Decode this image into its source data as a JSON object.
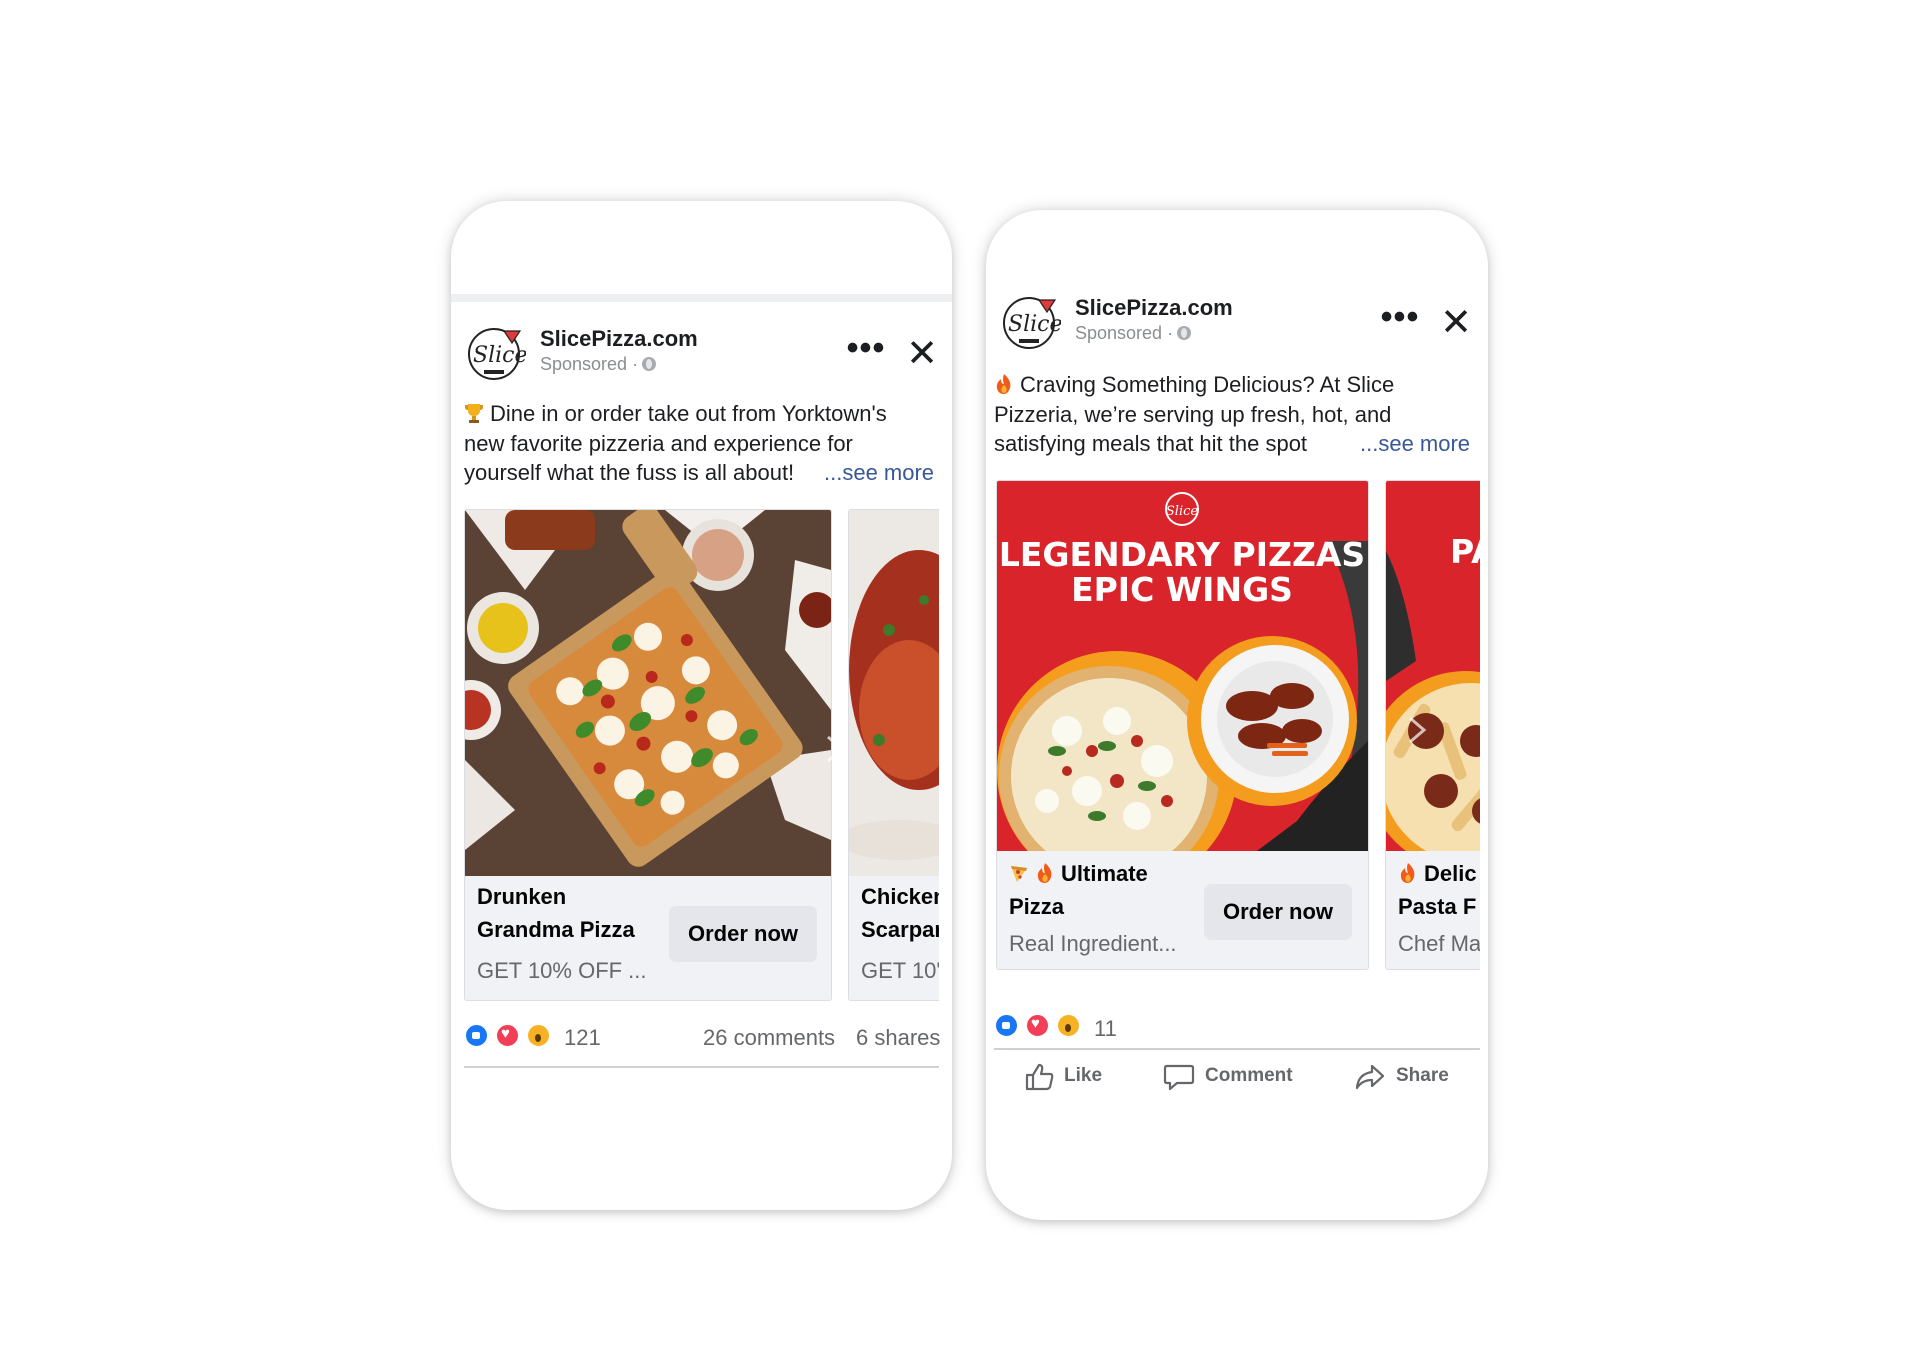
{
  "ad1": {
    "page_name": "SlicePizza.com",
    "sponsored": "Sponsored ·",
    "more_label": "•••",
    "close_label": "✕",
    "text_lines": [
      "Dine in or order take out from Yorktown's",
      "new favorite pizzeria and experience for",
      "yourself what the fuss is all about!"
    ],
    "see_more": "...see more",
    "cards": [
      {
        "title_line1": "Drunken",
        "title_line2": "Grandma Pizza",
        "description": "GET 10% OFF ...",
        "cta": "Order now"
      },
      {
        "title_line1": "Chicken",
        "title_line2": "Scarpar",
        "description": "GET 10'"
      }
    ],
    "reaction_count": "121",
    "comments": "26 comments",
    "shares": "6 shares"
  },
  "ad2": {
    "page_name": "SlicePizza.com",
    "sponsored": "Sponsored ·",
    "more_label": "•••",
    "close_label": "✕",
    "text_lines": [
      "Craving Something Delicious? At Slice",
      "Pizzeria, we’re serving up fresh, hot, and",
      "satisfying meals that hit the spot"
    ],
    "see_more": "...see more",
    "cards": [
      {
        "headline_line1": "LEGENDARY PIZZAS",
        "headline_line2": "EPIC WINGS",
        "title_line1": "Ultimate",
        "title_line2": "Pizza",
        "description": "Real Ingredient...",
        "cta": "Order now"
      },
      {
        "headline": "PA",
        "title_line1": "Delic",
        "title_line2": "Pasta F",
        "description": "Chef Ma"
      }
    ],
    "reaction_count": "11",
    "actions": {
      "like": "Like",
      "comment": "Comment",
      "share": "Share"
    }
  },
  "colors": {
    "link": "#385898",
    "cta_bg": "#e4e6eb",
    "ad_red": "#d8242a",
    "facebook_blue": "#1877f2"
  },
  "icons": [
    "slice-logo-icon",
    "globe-icon",
    "more-icon",
    "close-icon",
    "trophy-icon",
    "fire-icon",
    "pizza-icon",
    "like-icon",
    "comment-icon",
    "share-icon",
    "chevron-right-icon"
  ]
}
